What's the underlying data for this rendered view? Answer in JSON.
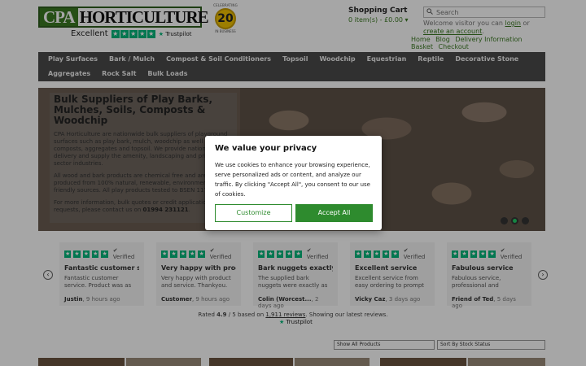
{
  "logo": {
    "part1": "CPA",
    "part2": "HORTICULTURE"
  },
  "trustpilot": {
    "rating_word": "Excellent",
    "brand": "Trustpilot"
  },
  "badge": {
    "top": "CELEBRATING",
    "years": "20",
    "bottom": "IN BUSINESS"
  },
  "cart": {
    "title": "Shopping Cart",
    "items": "0 item(s) - £0.00 ▾"
  },
  "search": {
    "placeholder": "Search"
  },
  "welcome": {
    "text": "Welcome visitor you can ",
    "login": "login",
    "or": " or ",
    "create": "create an account",
    "end": "."
  },
  "toplinks": [
    "Home",
    "Blog",
    "Delivery Information",
    "Basket",
    "Checkout"
  ],
  "nav": [
    "Play Surfaces",
    "Bark / Mulch",
    "Compost & Soil Conditioners",
    "Topsoil",
    "Woodchip",
    "Equestrian",
    "Reptile",
    "Decorative Stone",
    "Aggregates",
    "Rock Salt",
    "Bulk Loads"
  ],
  "hero": {
    "title": "Bulk Suppliers of Play Barks, Mulches, Soils, Composts & Woodchip",
    "p1": "CPA Horticulture are nationwide bulk suppliers of playground surfaces such as play bark, mulch, woodchip as well as composts, aggregates and topsoil. We provide national delivery and supply the amenity, landscaping and private sector industries.",
    "p2": "All wood and bark products are chemical free and are produced from 100% natural, renewable, environmentally friendly sources. All play products tested to BSEN 1177:1998.",
    "p3": "For more information, bulk quotes or credit application requests, please contact us on ",
    "phone": "01994 231121",
    "p3_end": "."
  },
  "reviews": [
    {
      "title": "Fantastic customer s...",
      "body": "Fantastic customer service. Product was as described...",
      "author": "Justin",
      "time": ", 9 hours ago"
    },
    {
      "title": "Very happy with prod...",
      "body": "Very happy with product and service. Thankyou.",
      "author": "Customer",
      "time": ", 9 hours ago"
    },
    {
      "title": "Bark nuggets exactly...",
      "body": "The supplied bark nuggets were exactly as shown in...",
      "author": "Colin (Worcest...",
      "time": ", 2 days ago"
    },
    {
      "title": "Excellent service",
      "body": "Excellent service from easy ordering to prompt delive...",
      "author": "Vicky Caz",
      "time": ", 3 days ago"
    },
    {
      "title": "Fabulous service",
      "body": "Fabulous service, professional and friendly...",
      "author": "Friend of Ted",
      "time": ", 5 days ago"
    }
  ],
  "verified_label": "Verified",
  "rating": {
    "prefix": "Rated ",
    "score": "4.9",
    "mid": " / 5 based on ",
    "reviews": "1,911 reviews",
    "suffix": ". Showing our latest reviews."
  },
  "filters": {
    "show": "Show All Products",
    "sort": "Sort By Stock Status"
  },
  "cookie": {
    "title": "We value your privacy",
    "text": "We use cookies to enhance your browsing experience, serve personalized ads or content, and analyze our traffic. By clicking \"Accept All\", you consent to our use of cookies.",
    "customize": "Customize",
    "accept": "Accept All"
  },
  "colors": {
    "brand_green": "#3b7a22",
    "trustpilot_green": "#00b67a",
    "nav_bg": "#4a4a4a",
    "accept_green": "#2e8b2e"
  }
}
